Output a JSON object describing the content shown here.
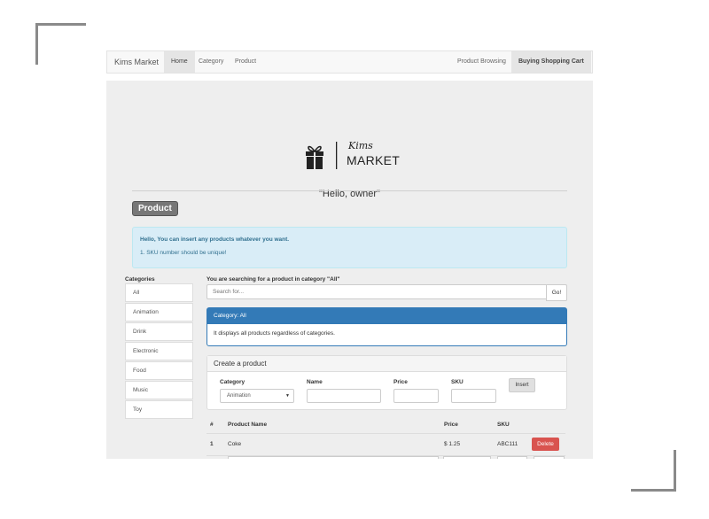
{
  "navbar": {
    "brand": "Kims Market",
    "left_items": [
      "Home",
      "Category",
      "Product"
    ],
    "active": "Home",
    "right_items": [
      "Product Browsing",
      "Buying Shopping Cart"
    ]
  },
  "logo": {
    "script_text": "Kims",
    "text": "MARKET"
  },
  "greeting": "\"Hello, owner\"",
  "section_label": "Product",
  "alert": {
    "title": "Hello, You can insert any products whatever you want.",
    "item": "1. SKU number should be unique!"
  },
  "categories": {
    "title": "Categories",
    "items": [
      "All",
      "Animation",
      "Drink",
      "Electronic",
      "Food",
      "Music",
      "Toy"
    ]
  },
  "search": {
    "label": "You are searching for a product in category \"All\"",
    "placeholder": "Search for...",
    "button": "Go!"
  },
  "category_panel": {
    "heading": "Category: All",
    "body": "It displays all products regardless of categories."
  },
  "create_panel": {
    "heading": "Create a product",
    "category_label": "Category",
    "category_value": "Animation",
    "name_label": "Name",
    "price_label": "Price",
    "sku_label": "SKU",
    "insert_button": "Insert"
  },
  "table": {
    "headers": [
      "#",
      "Product Name",
      "Price",
      "SKU"
    ],
    "rows": [
      {
        "num": "1",
        "name": "Coke",
        "price": "$ 1.25",
        "sku": "ABC111",
        "action": "Delete"
      }
    ]
  },
  "colors": {
    "primary": "#337ab7",
    "danger": "#d9534f",
    "alert_bg": "#d9edf7",
    "alert_text": "#31708f",
    "jumbotron_bg": "#eeeeee"
  }
}
